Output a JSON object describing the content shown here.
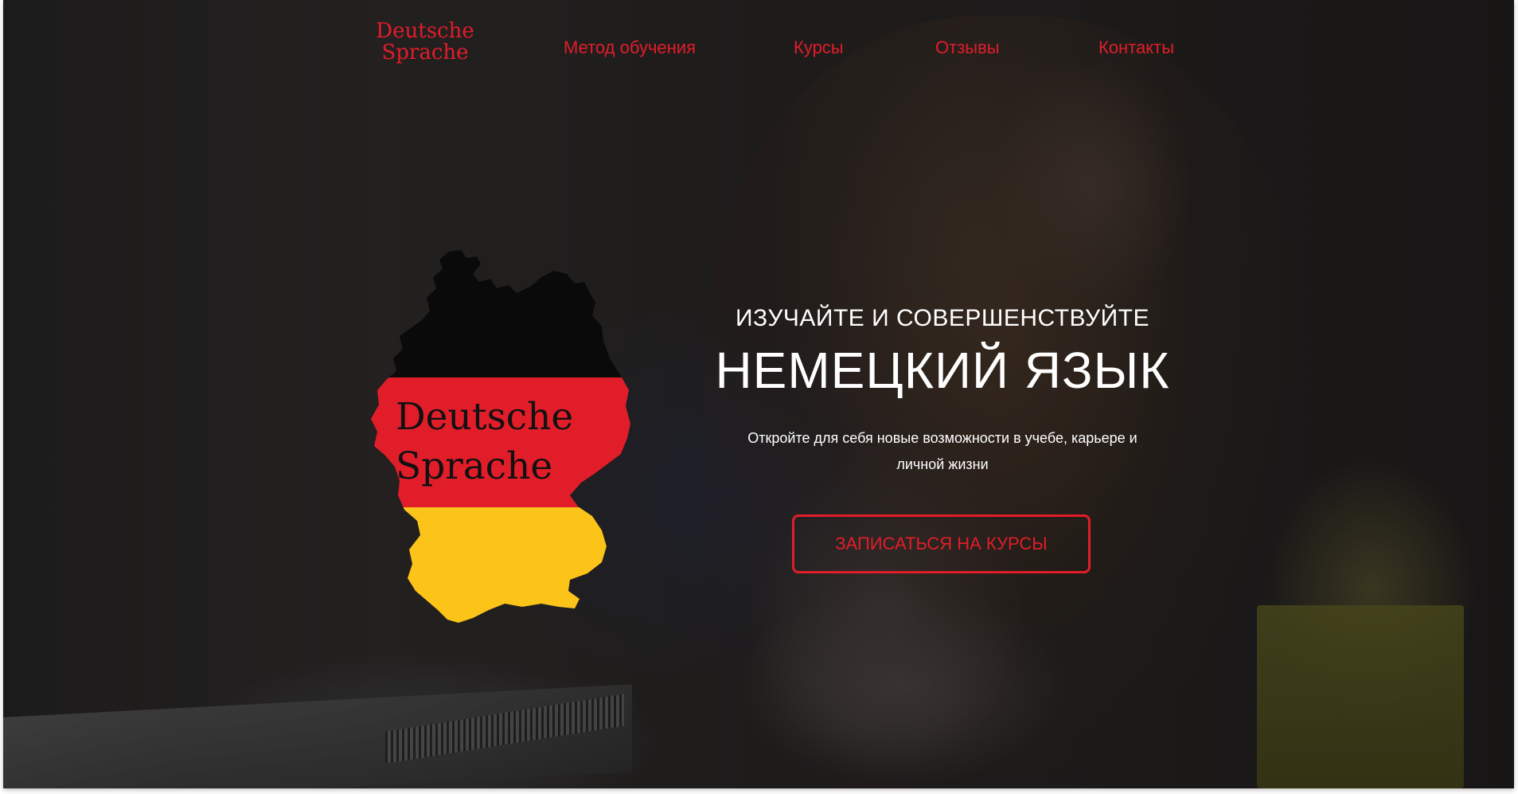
{
  "brand": {
    "line1": "Deutsche",
    "line2": "Sprache"
  },
  "nav": {
    "items": [
      {
        "label": "Метод обучения"
      },
      {
        "label": "Курсы"
      },
      {
        "label": "Отзывы"
      },
      {
        "label": "Контакты"
      }
    ]
  },
  "hero": {
    "logo_line1": "Deutsche",
    "logo_line2": "Sprache",
    "subtitle": "ИЗУЧАЙТЕ И СОВЕРШЕНСТВУЙТЕ",
    "title": "НЕМЕЦКИЙ ЯЗЫК",
    "description_line1": "Откройте для себя новые возможности в учебе, карьере и",
    "description_line2": "личной жизни",
    "cta_label": "ЗАПИСАТЬСЯ НА КУРСЫ"
  },
  "colors": {
    "accent": "#e21d2a",
    "flag_black": "#0a0a0a",
    "flag_red": "#e21d2a",
    "flag_gold": "#fcc419"
  }
}
